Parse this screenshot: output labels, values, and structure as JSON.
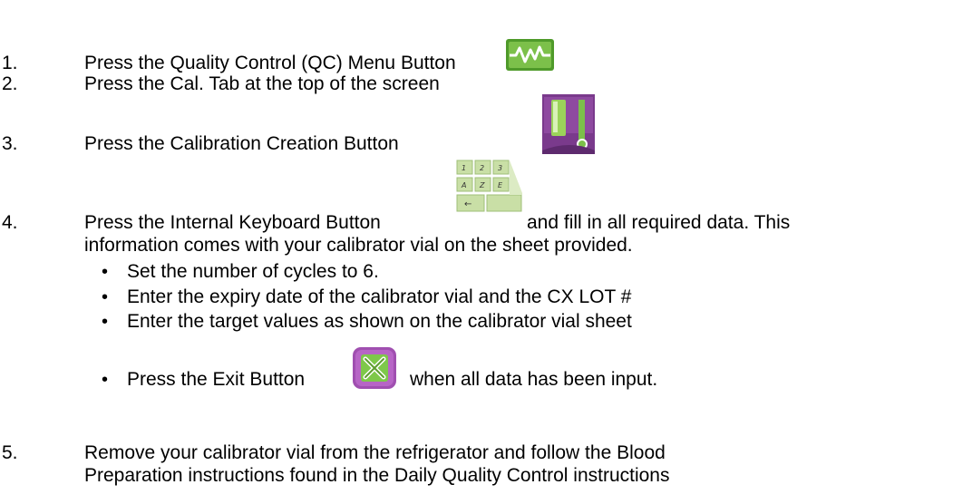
{
  "steps": [
    {
      "number": "1.",
      "text": "Press the Quality Control (QC) Menu Button"
    },
    {
      "number": "2.",
      "text": "Press the Cal. Tab at the top of the screen"
    },
    {
      "number": "3.",
      "text": "Press the Calibration Creation Button"
    },
    {
      "number": "4.",
      "text_before": "Press the Internal Keyboard Button",
      "text_after": "and fill in all required data. This",
      "continuation": "information comes with your calibrator vial on the sheet provided."
    },
    {
      "number": "5.",
      "text": "Remove your calibrator vial from the refrigerator and follow the Blood",
      "continuation": "Preparation instructions found in the Daily Quality Control instructions"
    }
  ],
  "substeps": [
    {
      "bullet": "•",
      "text": "Set the number of cycles to 6."
    },
    {
      "bullet": "•",
      "text": "Enter the expiry date of the calibrator vial and the CX LOT #"
    },
    {
      "bullet": "•",
      "text": "Enter the target values as shown on the calibrator vial sheet"
    },
    {
      "bullet": "•",
      "text_before": "Press the Exit Button",
      "text_after": "when all data has been input."
    }
  ],
  "keyboard_icon_keys": [
    "1",
    "2",
    "3",
    "A",
    "Z",
    "E",
    "←"
  ],
  "icons": {
    "qc_menu": "qc-waveform-icon",
    "calibration_creation": "calibration-vial-icon",
    "internal_keyboard": "keyboard-icon",
    "exit": "exit-x-icon"
  },
  "colors": {
    "qc_green": "#5fa830",
    "cal_purple": "#7a3a8c",
    "exit_purple": "#a04fb0",
    "exit_green": "#7ec84a",
    "key_green": "#c9dfa6"
  }
}
